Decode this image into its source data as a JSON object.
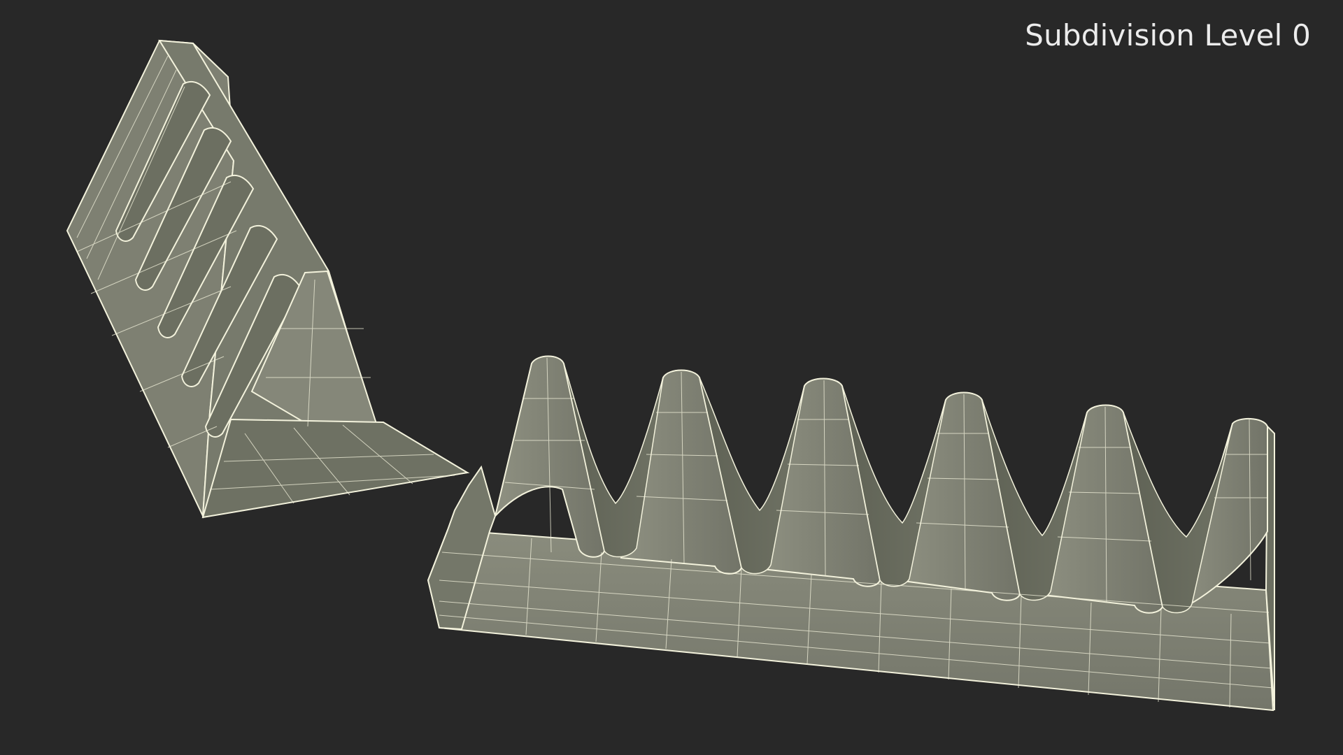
{
  "viewport": {
    "label": "Subdivision Level 0",
    "background": "#282828"
  },
  "scene": {
    "objects": [
      {
        "name": "triangular-chocolate-piece"
      },
      {
        "name": "chocolate-bar-segment"
      }
    ],
    "colors": {
      "surface": "#7b7d6e",
      "surface_dark": "#676a5b",
      "surface_light": "#8c8e7f",
      "wire": "#f3f2dc"
    }
  }
}
